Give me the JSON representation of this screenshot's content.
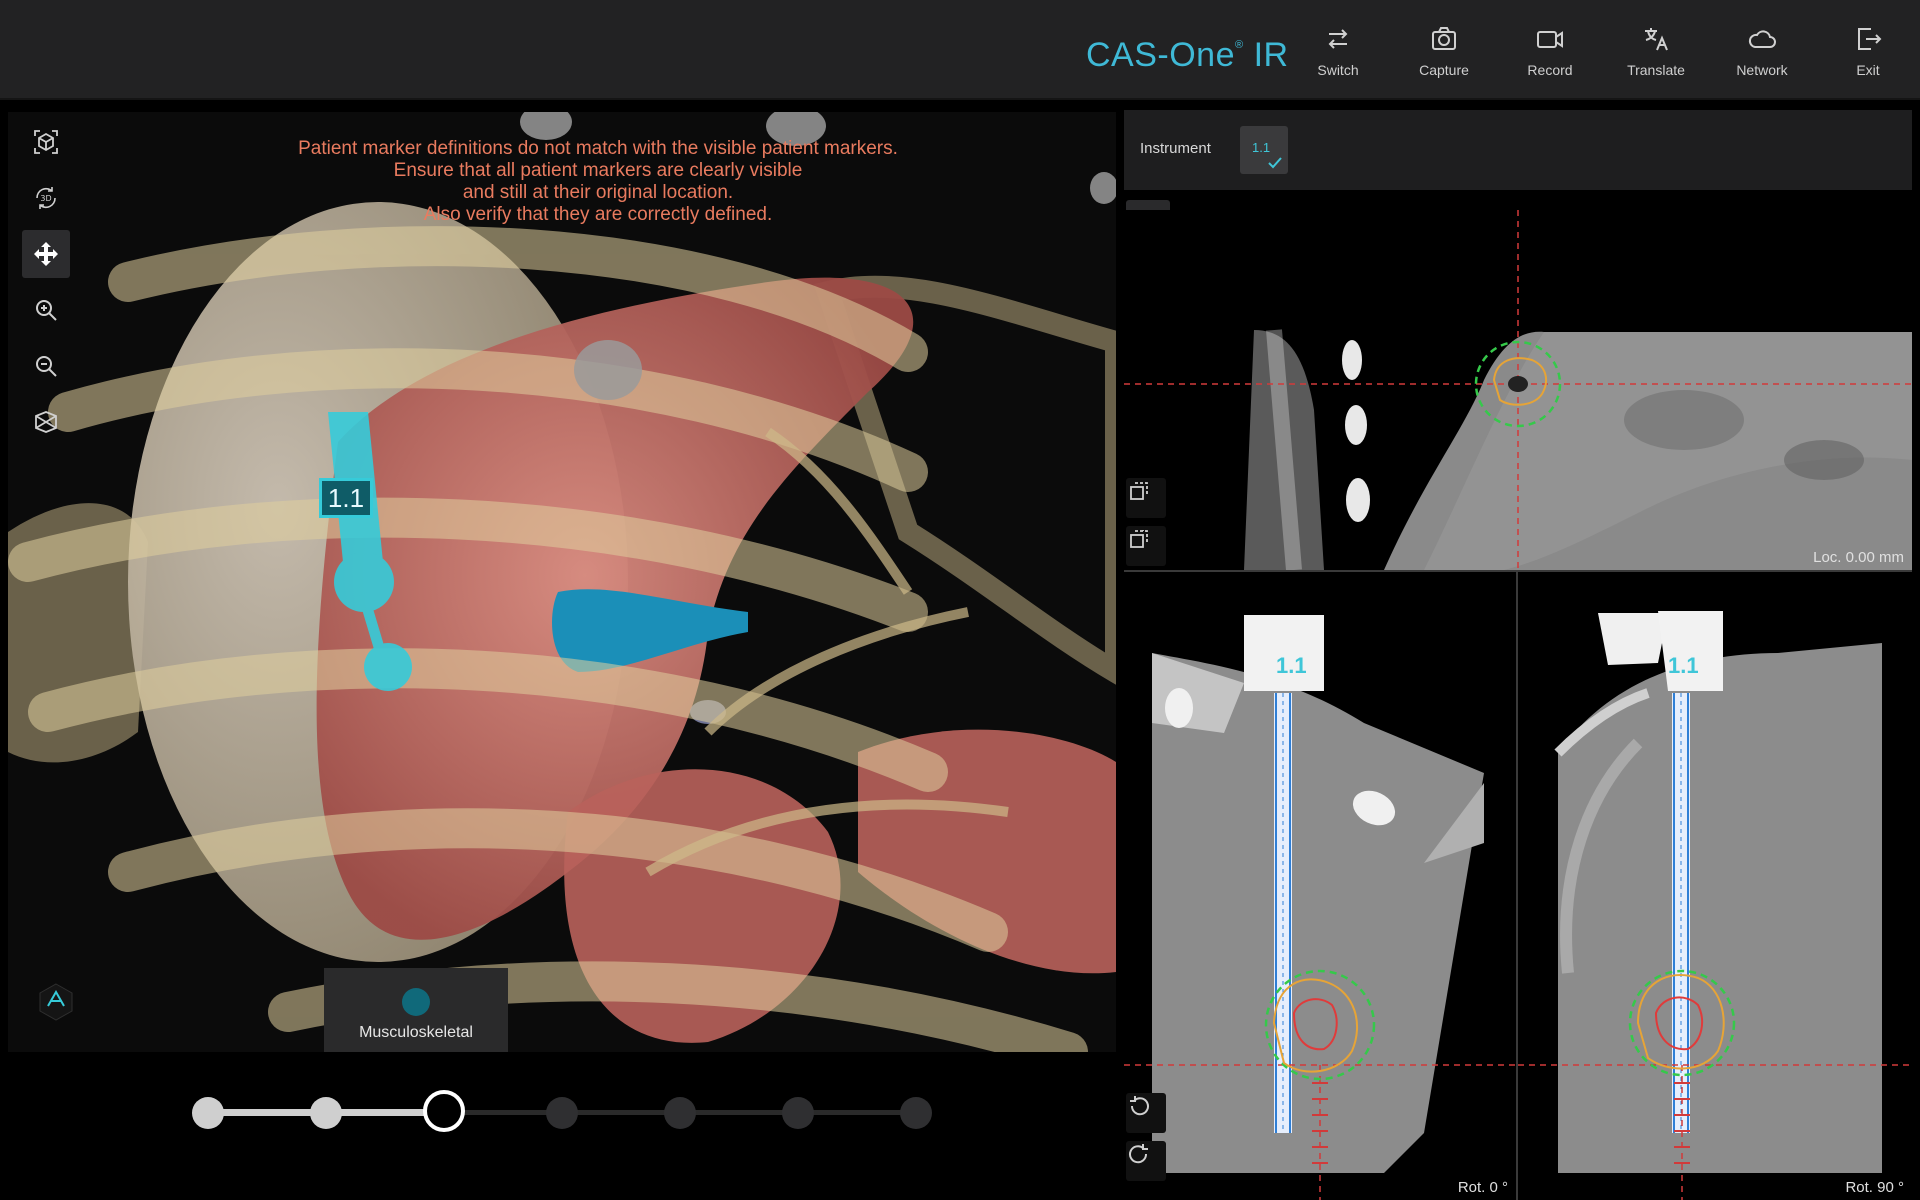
{
  "app": {
    "brand": "CAS-One",
    "brand_mark": "®",
    "brand_suffix": "IR"
  },
  "toolbar": [
    {
      "id": "switch",
      "label": "Switch",
      "icon": "switch-arrows-icon"
    },
    {
      "id": "capture",
      "label": "Capture",
      "icon": "camera-icon"
    },
    {
      "id": "record",
      "label": "Record",
      "icon": "video-camera-icon"
    },
    {
      "id": "translate",
      "label": "Translate",
      "icon": "translate-icon"
    },
    {
      "id": "network",
      "label": "Network",
      "icon": "cloud-icon"
    },
    {
      "id": "exit",
      "label": "Exit",
      "icon": "exit-icon"
    }
  ],
  "view3d": {
    "warning_lines": [
      "Patient marker definitions do not match with the visible patient markers.",
      "Ensure that all patient markers are clearly visible",
      "and still at their original location.",
      "Also verify that they are correctly defined."
    ],
    "side_tools": [
      {
        "icon": "reset-view-cube-icon",
        "active": false
      },
      {
        "icon": "rotate-3d-icon",
        "text": "3D",
        "active": false
      },
      {
        "icon": "pan-move-icon",
        "active": true
      },
      {
        "icon": "zoom-in-icon",
        "active": false
      },
      {
        "icon": "zoom-out-icon",
        "active": false
      },
      {
        "icon": "layers-view-icon",
        "active": false
      }
    ],
    "instrument_label": "1.1",
    "layer_name": "Musculoskeletal",
    "colors": {
      "warning": "#e97b5f",
      "instrument": "#36cbd9",
      "bone": "#d9c79c",
      "liver": "#c86a62",
      "vessel": "#1b8fb8"
    }
  },
  "workflow_slider": {
    "step_count": 7,
    "current_step": 3
  },
  "instrument_panel": {
    "label": "Instrument",
    "selected": "1.1",
    "accent": "#3fc6d8"
  },
  "ct_views": {
    "top_caption": "Loc. 0.00 mm",
    "left_caption": "Rot. 0 °",
    "right_caption": "Rot. 90 °",
    "instrument_tag": "1.1",
    "colors": {
      "crosshair": "#d23a3a",
      "margin_ring": "#35c94a",
      "zone_outer": "#e6a437",
      "zone_inner": "#e03b3b"
    }
  }
}
